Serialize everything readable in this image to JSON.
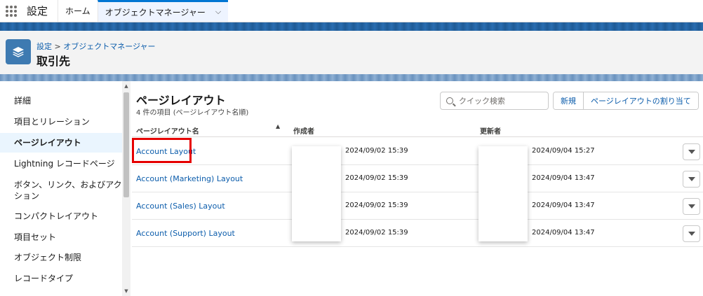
{
  "topnav": {
    "app_name": "設定",
    "tabs": [
      {
        "label": "ホーム"
      },
      {
        "label": "オブジェクトマネージャー"
      }
    ]
  },
  "header": {
    "breadcrumb": {
      "root": "設定",
      "separator": ">",
      "current": "オブジェクトマネージャー"
    },
    "title": "取引先"
  },
  "sidebar": {
    "items": [
      {
        "label": "詳細"
      },
      {
        "label": "項目とリレーション"
      },
      {
        "label": "ページレイアウト",
        "active": true
      },
      {
        "label": "Lightning レコードページ"
      },
      {
        "label": "ボタン、リンク、およびアクション"
      },
      {
        "label": "コンパクトレイアウト"
      },
      {
        "label": "項目セット"
      },
      {
        "label": "オブジェクト制限"
      },
      {
        "label": "レコードタイプ"
      }
    ]
  },
  "main": {
    "title": "ページレイアウト",
    "subtitle": "4 件の項目 (ページレイアウト名順)",
    "search_placeholder": "クイック検索",
    "buttons": {
      "new": "新規",
      "assign": "ページレイアウトの割り当て"
    },
    "columns": {
      "name": "ページレイアウト名",
      "created_by": "作成者",
      "modified_by": "更新者"
    },
    "rows": [
      {
        "name": "Account Layout",
        "created": "2024/09/02 15:39",
        "modified": "2024/09/04 15:27"
      },
      {
        "name": "Account (Marketing) Layout",
        "created": "2024/09/02 15:39",
        "modified": "2024/09/04 13:47"
      },
      {
        "name": "Account (Sales) Layout",
        "created": "2024/09/02 15:39",
        "modified": "2024/09/04 13:47"
      },
      {
        "name": "Account (Support) Layout",
        "created": "2024/09/02 15:39",
        "modified": "2024/09/04 13:47"
      }
    ]
  },
  "colors": {
    "accent": "#0176d3",
    "link": "#0b5cab",
    "highlight": "#e60000",
    "object_icon": "#3e7ab1"
  }
}
